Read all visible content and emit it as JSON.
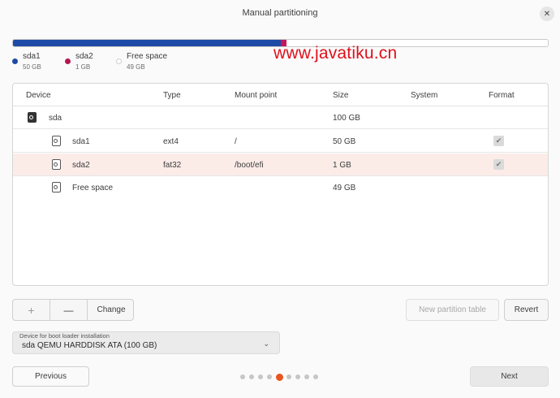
{
  "window": {
    "title": "Manual partitioning"
  },
  "usage": {
    "segments": [
      {
        "name": "sda1",
        "fraction": 0.5,
        "color": "#1d4aa6"
      },
      {
        "name": "sda2",
        "fraction": 0.01,
        "color": "#c2185b"
      },
      {
        "name": "free",
        "fraction": 0.49,
        "color": "#ffffff"
      }
    ],
    "legend": [
      {
        "name": "sda1",
        "size": "50 GB",
        "color": "#1d4aa6"
      },
      {
        "name": "sda2",
        "size": "1 GB",
        "color": "#b5164f"
      },
      {
        "name": "Free space",
        "size": "49 GB",
        "color": "#ffffff"
      }
    ]
  },
  "watermark": "www.javatiku.cn",
  "table": {
    "headers": {
      "device": "Device",
      "type": "Type",
      "mount": "Mount point",
      "size": "Size",
      "system": "System",
      "format": "Format"
    },
    "rows": [
      {
        "device": "sda",
        "type": "",
        "mount": "",
        "size": "100 GB",
        "format": false
      },
      {
        "device": "sda1",
        "type": "ext4",
        "mount": "/",
        "size": "50 GB",
        "format": true
      },
      {
        "device": "sda2",
        "type": "fat32",
        "mount": "/boot/efi",
        "size": "1 GB",
        "format": true
      },
      {
        "device": "Free space",
        "type": "",
        "mount": "",
        "size": "49 GB",
        "format": false
      }
    ],
    "selected_row": 2
  },
  "toolbar": {
    "add_label": "+",
    "remove_label": "—",
    "change_label": "Change",
    "new_table_label": "New partition table",
    "revert_label": "Revert"
  },
  "bootloader": {
    "label": "Device for boot loader installation",
    "value": "sda QEMU HARDDISK ATA (100 GB)"
  },
  "nav": {
    "previous_label": "Previous",
    "next_label": "Next",
    "page_count": 9,
    "current_page": 5
  },
  "colors": {
    "accent": "#e95420"
  }
}
